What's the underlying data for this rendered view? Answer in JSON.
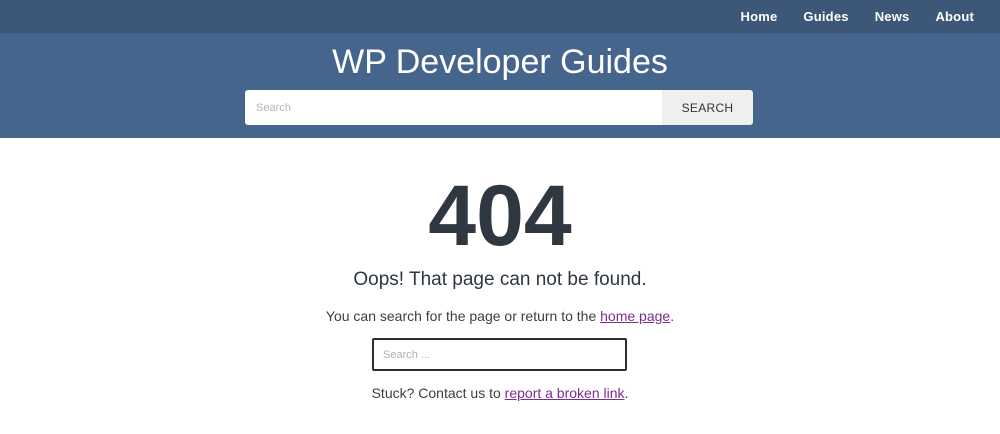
{
  "nav": {
    "items": [
      "Home",
      "Guides",
      "News",
      "About"
    ]
  },
  "header": {
    "site_title": "WP Developer Guides",
    "search_placeholder": "Search",
    "search_button": "SEARCH"
  },
  "error": {
    "code": "404",
    "headline": "Oops! That page can not be found.",
    "para1_prefix": "You can search for the page or return to the ",
    "para1_link": "home page",
    "para1_suffix": ".",
    "search_placeholder": "Search ...",
    "para2_prefix": "Stuck? Contact us to ",
    "para2_link": "report a broken link",
    "para2_suffix": "."
  },
  "colors": {
    "topbar": "#3d5778",
    "hero": "#46658d",
    "link": "#7b2d8f",
    "text": "#2e3741"
  }
}
